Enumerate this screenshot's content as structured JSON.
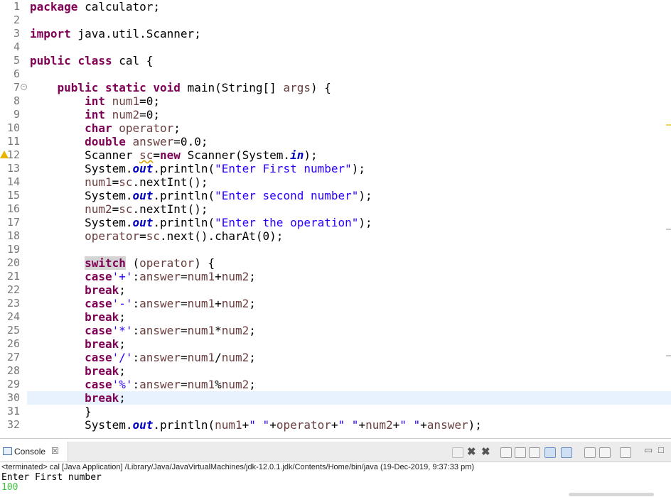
{
  "editor": {
    "current_line": 30,
    "lines": [
      {
        "n": "1",
        "tokens": [
          {
            "t": "package",
            "c": "kw"
          },
          {
            "t": " calculator;"
          }
        ]
      },
      {
        "n": "2",
        "tokens": []
      },
      {
        "n": "3",
        "tokens": [
          {
            "t": "import",
            "c": "kw"
          },
          {
            "t": " java.util.Scanner;"
          }
        ]
      },
      {
        "n": "4",
        "tokens": []
      },
      {
        "n": "5",
        "tokens": [
          {
            "t": "public",
            "c": "kw"
          },
          {
            "t": " "
          },
          {
            "t": "class",
            "c": "kw"
          },
          {
            "t": " cal {"
          }
        ]
      },
      {
        "n": "6",
        "tokens": []
      },
      {
        "n": "7",
        "fold": true,
        "tokens": [
          {
            "t": "    "
          },
          {
            "t": "public",
            "c": "kw"
          },
          {
            "t": " "
          },
          {
            "t": "static",
            "c": "kw"
          },
          {
            "t": " "
          },
          {
            "t": "void",
            "c": "kw"
          },
          {
            "t": " main(String[] "
          },
          {
            "t": "args",
            "c": "var"
          },
          {
            "t": ") {"
          }
        ]
      },
      {
        "n": "8",
        "tokens": [
          {
            "t": "        "
          },
          {
            "t": "int",
            "c": "kw"
          },
          {
            "t": " "
          },
          {
            "t": "num1",
            "c": "var"
          },
          {
            "t": "=0;"
          }
        ]
      },
      {
        "n": "9",
        "tokens": [
          {
            "t": "        "
          },
          {
            "t": "int",
            "c": "kw"
          },
          {
            "t": " "
          },
          {
            "t": "num2",
            "c": "var"
          },
          {
            "t": "=0;"
          }
        ]
      },
      {
        "n": "10",
        "tokens": [
          {
            "t": "        "
          },
          {
            "t": "char",
            "c": "kw"
          },
          {
            "t": " "
          },
          {
            "t": "operator",
            "c": "var"
          },
          {
            "t": ";"
          }
        ]
      },
      {
        "n": "11",
        "tokens": [
          {
            "t": "        "
          },
          {
            "t": "double",
            "c": "kw"
          },
          {
            "t": " "
          },
          {
            "t": "answer",
            "c": "var"
          },
          {
            "t": "=0.0;"
          }
        ]
      },
      {
        "n": "12",
        "warn": true,
        "tokens": [
          {
            "t": "        Scanner "
          },
          {
            "t": "sc",
            "c": "var uline"
          },
          {
            "t": "="
          },
          {
            "t": "new",
            "c": "kw"
          },
          {
            "t": " Scanner(System."
          },
          {
            "t": "in",
            "c": "fld"
          },
          {
            "t": ");"
          }
        ]
      },
      {
        "n": "13",
        "tokens": [
          {
            "t": "        System."
          },
          {
            "t": "out",
            "c": "fld"
          },
          {
            "t": ".println("
          },
          {
            "t": "\"Enter First number\"",
            "c": "str"
          },
          {
            "t": ");"
          }
        ]
      },
      {
        "n": "14",
        "tokens": [
          {
            "t": "        "
          },
          {
            "t": "num1",
            "c": "var"
          },
          {
            "t": "="
          },
          {
            "t": "sc",
            "c": "var"
          },
          {
            "t": ".nextInt();"
          }
        ]
      },
      {
        "n": "15",
        "tokens": [
          {
            "t": "        System."
          },
          {
            "t": "out",
            "c": "fld"
          },
          {
            "t": ".println("
          },
          {
            "t": "\"Enter second number\"",
            "c": "str"
          },
          {
            "t": ");"
          }
        ]
      },
      {
        "n": "16",
        "tokens": [
          {
            "t": "        "
          },
          {
            "t": "num2",
            "c": "var"
          },
          {
            "t": "="
          },
          {
            "t": "sc",
            "c": "var"
          },
          {
            "t": ".nextInt();"
          }
        ]
      },
      {
        "n": "17",
        "tokens": [
          {
            "t": "        System."
          },
          {
            "t": "out",
            "c": "fld"
          },
          {
            "t": ".println("
          },
          {
            "t": "\"Enter the operation\"",
            "c": "str"
          },
          {
            "t": ");"
          }
        ]
      },
      {
        "n": "18",
        "tokens": [
          {
            "t": "        "
          },
          {
            "t": "operator",
            "c": "var"
          },
          {
            "t": "="
          },
          {
            "t": "sc",
            "c": "var"
          },
          {
            "t": ".next().charAt(0);"
          }
        ]
      },
      {
        "n": "19",
        "tokens": []
      },
      {
        "n": "20",
        "tokens": [
          {
            "t": "        "
          },
          {
            "t": "switch",
            "c": "kw hl"
          },
          {
            "t": " ("
          },
          {
            "t": "operator",
            "c": "var"
          },
          {
            "t": ") {"
          }
        ]
      },
      {
        "n": "21",
        "tokens": [
          {
            "t": "        "
          },
          {
            "t": "case",
            "c": "kw"
          },
          {
            "t": "'+'",
            "c": "str"
          },
          {
            "t": ":"
          },
          {
            "t": "answer",
            "c": "var"
          },
          {
            "t": "="
          },
          {
            "t": "num1",
            "c": "var"
          },
          {
            "t": "+"
          },
          {
            "t": "num2",
            "c": "var"
          },
          {
            "t": ";"
          }
        ]
      },
      {
        "n": "22",
        "tokens": [
          {
            "t": "        "
          },
          {
            "t": "break",
            "c": "kw"
          },
          {
            "t": ";"
          }
        ]
      },
      {
        "n": "23",
        "tokens": [
          {
            "t": "        "
          },
          {
            "t": "case",
            "c": "kw"
          },
          {
            "t": "'-'",
            "c": "str"
          },
          {
            "t": ":"
          },
          {
            "t": "answer",
            "c": "var"
          },
          {
            "t": "="
          },
          {
            "t": "num1",
            "c": "var"
          },
          {
            "t": "+"
          },
          {
            "t": "num2",
            "c": "var"
          },
          {
            "t": ";"
          }
        ]
      },
      {
        "n": "24",
        "tokens": [
          {
            "t": "        "
          },
          {
            "t": "break",
            "c": "kw"
          },
          {
            "t": ";"
          }
        ]
      },
      {
        "n": "25",
        "tokens": [
          {
            "t": "        "
          },
          {
            "t": "case",
            "c": "kw"
          },
          {
            "t": "'*'",
            "c": "str"
          },
          {
            "t": ":"
          },
          {
            "t": "answer",
            "c": "var"
          },
          {
            "t": "="
          },
          {
            "t": "num1",
            "c": "var"
          },
          {
            "t": "*"
          },
          {
            "t": "num2",
            "c": "var"
          },
          {
            "t": ";"
          }
        ]
      },
      {
        "n": "26",
        "tokens": [
          {
            "t": "        "
          },
          {
            "t": "break",
            "c": "kw"
          },
          {
            "t": ";"
          }
        ]
      },
      {
        "n": "27",
        "tokens": [
          {
            "t": "        "
          },
          {
            "t": "case",
            "c": "kw"
          },
          {
            "t": "'/'",
            "c": "str"
          },
          {
            "t": ":"
          },
          {
            "t": "answer",
            "c": "var"
          },
          {
            "t": "="
          },
          {
            "t": "num1",
            "c": "var"
          },
          {
            "t": "/"
          },
          {
            "t": "num2",
            "c": "var"
          },
          {
            "t": ";"
          }
        ]
      },
      {
        "n": "28",
        "tokens": [
          {
            "t": "        "
          },
          {
            "t": "break",
            "c": "kw"
          },
          {
            "t": ";"
          }
        ]
      },
      {
        "n": "29",
        "tokens": [
          {
            "t": "        "
          },
          {
            "t": "case",
            "c": "kw"
          },
          {
            "t": "'%'",
            "c": "str"
          },
          {
            "t": ":"
          },
          {
            "t": "answer",
            "c": "var"
          },
          {
            "t": "="
          },
          {
            "t": "num1",
            "c": "var"
          },
          {
            "t": "%"
          },
          {
            "t": "num2",
            "c": "var"
          },
          {
            "t": ";"
          }
        ]
      },
      {
        "n": "30",
        "tokens": [
          {
            "t": "        "
          },
          {
            "t": "break",
            "c": "kw"
          },
          {
            "t": ";"
          }
        ]
      },
      {
        "n": "31",
        "tokens": [
          {
            "t": "        }"
          }
        ]
      },
      {
        "n": "32",
        "tokens": [
          {
            "t": "        System."
          },
          {
            "t": "out",
            "c": "fld"
          },
          {
            "t": ".println("
          },
          {
            "t": "num1",
            "c": "var"
          },
          {
            "t": "+"
          },
          {
            "t": "\" \"",
            "c": "str"
          },
          {
            "t": "+"
          },
          {
            "t": "operator",
            "c": "var"
          },
          {
            "t": "+"
          },
          {
            "t": "\" \"",
            "c": "str"
          },
          {
            "t": "+"
          },
          {
            "t": "num2",
            "c": "var"
          },
          {
            "t": "+"
          },
          {
            "t": "\" \"",
            "c": "str"
          },
          {
            "t": "+"
          },
          {
            "t": "answer",
            "c": "var"
          },
          {
            "t": ");"
          }
        ]
      }
    ]
  },
  "console": {
    "tab_label": "Console",
    "tab_icon": "console-icon",
    "close_glyph": "☒",
    "status": "<terminated> cal [Java Application] /Library/Java/JavaVirtualMachines/jdk-12.0.1.jdk/Contents/Home/bin/java (19-Dec-2019, 9:37:33 pm)",
    "output": [
      {
        "text": "Enter First number",
        "kind": "stdout"
      },
      {
        "text": "100",
        "kind": "stdin"
      }
    ],
    "toolbar_icons": [
      "terminate-icon",
      "remove-launch-icon",
      "remove-all-icon",
      "clear-console-icon",
      "scroll-lock-icon",
      "word-wrap-icon",
      "show-stdout-icon",
      "show-stderr-icon",
      "pin-console-icon",
      "display-console-icon",
      "open-console-icon",
      "minimize-icon",
      "maximize-icon"
    ]
  },
  "colors": {
    "keyword": "#7f0055",
    "string": "#2a00ff",
    "static_field": "#0000c0",
    "variable": "#6a3e3e",
    "current_line": "#e8f2fe",
    "stdin": "#3fc43f"
  }
}
